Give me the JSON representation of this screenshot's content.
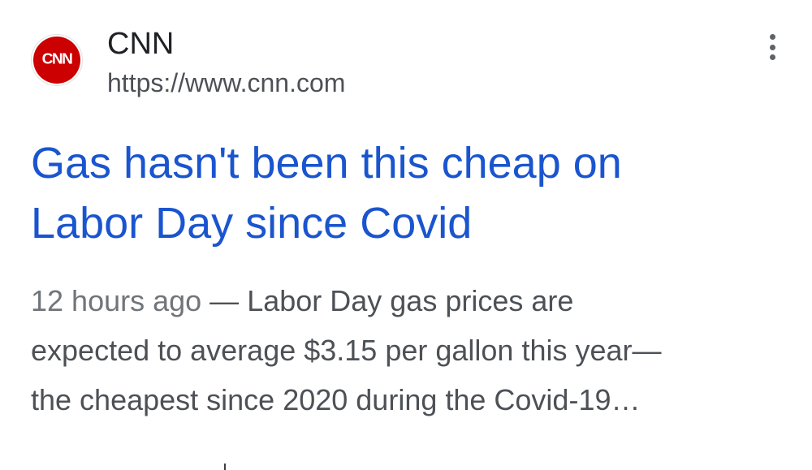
{
  "source": {
    "logo_text": "CNN",
    "logo_icon": "cnn-logo-icon",
    "name": "CNN",
    "url": "https://www.cnn.com"
  },
  "menu": {
    "icon": "more-vert-icon"
  },
  "result": {
    "headline_line1": "Gas hasn't been this cheap on",
    "headline_line2": "Labor Day since Covid",
    "time": "12 hours ago",
    "separator": " — ",
    "snippet_line1": "Labor Day gas prices are",
    "snippet_line2": "expected to average $3.15 per gallon this year—",
    "snippet_line3": "the cheapest since 2020 during the Covid-19…"
  },
  "colors": {
    "link": "#1a55cf",
    "brand": "#cc0000",
    "text_secondary": "#4d5156"
  }
}
